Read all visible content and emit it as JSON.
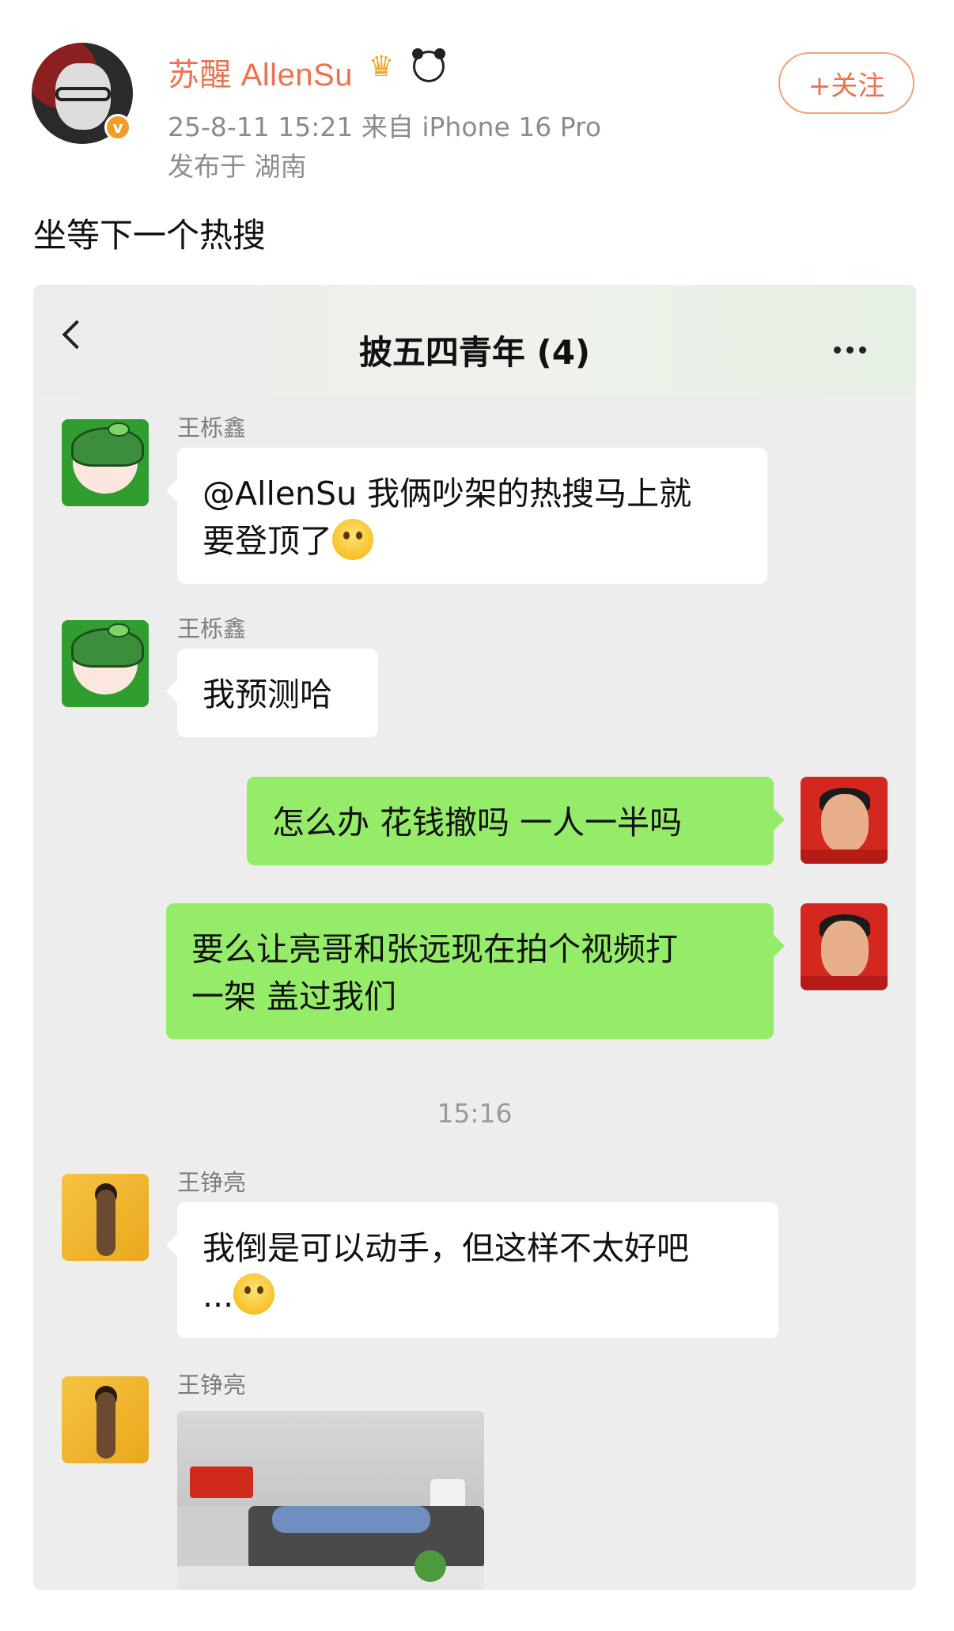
{
  "post": {
    "username": "苏醒 AllenSu",
    "meta": "25-8-11 15:21  来自 iPhone 16 Pro",
    "location": "发布于 湖南",
    "follow_label": "+关注",
    "verified_icon": "v",
    "text": "坐等下一个热搜"
  },
  "chat": {
    "title": "披五四青年 (4)",
    "messages": [
      {
        "sender": "王栎鑫",
        "text_1": "@AllenSu 我俩吵架的热搜马上就",
        "text_2": "要登顶了"
      },
      {
        "sender": "王栎鑫",
        "text": "我预测哈"
      },
      {
        "text": "怎么办 花钱撤吗 一人一半吗"
      },
      {
        "text_1": "要么让亮哥和张远现在拍个视频打",
        "text_2": "一架 盖过我们"
      }
    ],
    "timestamp": "15:16",
    "later": [
      {
        "sender": "王铮亮",
        "text_1": "我倒是可以动手，但这样不太好吧",
        "text_2": "..."
      },
      {
        "sender": "王铮亮"
      }
    ]
  },
  "colors": {
    "username": "#eb7350",
    "bubble_me": "#95ec69",
    "bubble_them": "#ffffff",
    "chat_bg": "#ededed"
  }
}
